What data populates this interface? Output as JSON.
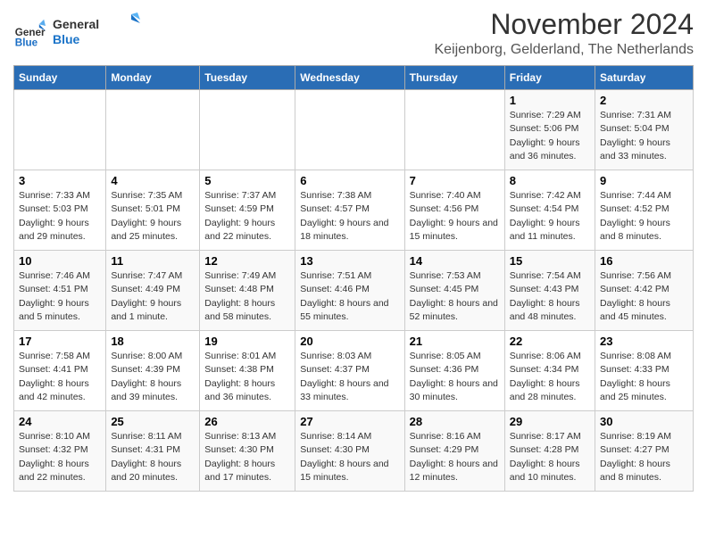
{
  "logo": {
    "line1": "General",
    "line2": "Blue"
  },
  "title": "November 2024",
  "subtitle": "Keijenborg, Gelderland, The Netherlands",
  "days_header": [
    "Sunday",
    "Monday",
    "Tuesday",
    "Wednesday",
    "Thursday",
    "Friday",
    "Saturday"
  ],
  "weeks": [
    {
      "cells": [
        {
          "day": "",
          "info": ""
        },
        {
          "day": "",
          "info": ""
        },
        {
          "day": "",
          "info": ""
        },
        {
          "day": "",
          "info": ""
        },
        {
          "day": "",
          "info": ""
        },
        {
          "day": "1",
          "info": "Sunrise: 7:29 AM\nSunset: 5:06 PM\nDaylight: 9 hours and 36 minutes."
        },
        {
          "day": "2",
          "info": "Sunrise: 7:31 AM\nSunset: 5:04 PM\nDaylight: 9 hours and 33 minutes."
        }
      ]
    },
    {
      "cells": [
        {
          "day": "3",
          "info": "Sunrise: 7:33 AM\nSunset: 5:03 PM\nDaylight: 9 hours and 29 minutes."
        },
        {
          "day": "4",
          "info": "Sunrise: 7:35 AM\nSunset: 5:01 PM\nDaylight: 9 hours and 25 minutes."
        },
        {
          "day": "5",
          "info": "Sunrise: 7:37 AM\nSunset: 4:59 PM\nDaylight: 9 hours and 22 minutes."
        },
        {
          "day": "6",
          "info": "Sunrise: 7:38 AM\nSunset: 4:57 PM\nDaylight: 9 hours and 18 minutes."
        },
        {
          "day": "7",
          "info": "Sunrise: 7:40 AM\nSunset: 4:56 PM\nDaylight: 9 hours and 15 minutes."
        },
        {
          "day": "8",
          "info": "Sunrise: 7:42 AM\nSunset: 4:54 PM\nDaylight: 9 hours and 11 minutes."
        },
        {
          "day": "9",
          "info": "Sunrise: 7:44 AM\nSunset: 4:52 PM\nDaylight: 9 hours and 8 minutes."
        }
      ]
    },
    {
      "cells": [
        {
          "day": "10",
          "info": "Sunrise: 7:46 AM\nSunset: 4:51 PM\nDaylight: 9 hours and 5 minutes."
        },
        {
          "day": "11",
          "info": "Sunrise: 7:47 AM\nSunset: 4:49 PM\nDaylight: 9 hours and 1 minute."
        },
        {
          "day": "12",
          "info": "Sunrise: 7:49 AM\nSunset: 4:48 PM\nDaylight: 8 hours and 58 minutes."
        },
        {
          "day": "13",
          "info": "Sunrise: 7:51 AM\nSunset: 4:46 PM\nDaylight: 8 hours and 55 minutes."
        },
        {
          "day": "14",
          "info": "Sunrise: 7:53 AM\nSunset: 4:45 PM\nDaylight: 8 hours and 52 minutes."
        },
        {
          "day": "15",
          "info": "Sunrise: 7:54 AM\nSunset: 4:43 PM\nDaylight: 8 hours and 48 minutes."
        },
        {
          "day": "16",
          "info": "Sunrise: 7:56 AM\nSunset: 4:42 PM\nDaylight: 8 hours and 45 minutes."
        }
      ]
    },
    {
      "cells": [
        {
          "day": "17",
          "info": "Sunrise: 7:58 AM\nSunset: 4:41 PM\nDaylight: 8 hours and 42 minutes."
        },
        {
          "day": "18",
          "info": "Sunrise: 8:00 AM\nSunset: 4:39 PM\nDaylight: 8 hours and 39 minutes."
        },
        {
          "day": "19",
          "info": "Sunrise: 8:01 AM\nSunset: 4:38 PM\nDaylight: 8 hours and 36 minutes."
        },
        {
          "day": "20",
          "info": "Sunrise: 8:03 AM\nSunset: 4:37 PM\nDaylight: 8 hours and 33 minutes."
        },
        {
          "day": "21",
          "info": "Sunrise: 8:05 AM\nSunset: 4:36 PM\nDaylight: 8 hours and 30 minutes."
        },
        {
          "day": "22",
          "info": "Sunrise: 8:06 AM\nSunset: 4:34 PM\nDaylight: 8 hours and 28 minutes."
        },
        {
          "day": "23",
          "info": "Sunrise: 8:08 AM\nSunset: 4:33 PM\nDaylight: 8 hours and 25 minutes."
        }
      ]
    },
    {
      "cells": [
        {
          "day": "24",
          "info": "Sunrise: 8:10 AM\nSunset: 4:32 PM\nDaylight: 8 hours and 22 minutes."
        },
        {
          "day": "25",
          "info": "Sunrise: 8:11 AM\nSunset: 4:31 PM\nDaylight: 8 hours and 20 minutes."
        },
        {
          "day": "26",
          "info": "Sunrise: 8:13 AM\nSunset: 4:30 PM\nDaylight: 8 hours and 17 minutes."
        },
        {
          "day": "27",
          "info": "Sunrise: 8:14 AM\nSunset: 4:30 PM\nDaylight: 8 hours and 15 minutes."
        },
        {
          "day": "28",
          "info": "Sunrise: 8:16 AM\nSunset: 4:29 PM\nDaylight: 8 hours and 12 minutes."
        },
        {
          "day": "29",
          "info": "Sunrise: 8:17 AM\nSunset: 4:28 PM\nDaylight: 8 hours and 10 minutes."
        },
        {
          "day": "30",
          "info": "Sunrise: 8:19 AM\nSunset: 4:27 PM\nDaylight: 8 hours and 8 minutes."
        }
      ]
    }
  ]
}
